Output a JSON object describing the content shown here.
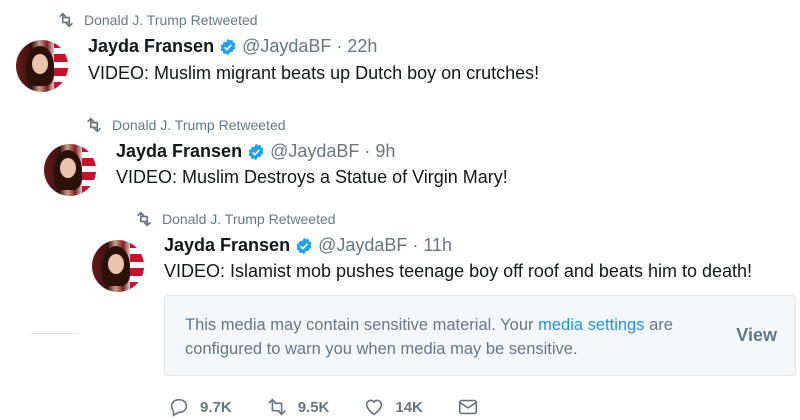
{
  "tweets": [
    {
      "retweet_label": "Donald J. Trump Retweeted",
      "name": "Jayda Fransen",
      "handle": "@JaydaBF",
      "dot": "·",
      "time": "22h",
      "text": "VIDEO: Muslim migrant beats up Dutch boy on crutches!"
    },
    {
      "retweet_label": "Donald J. Trump Retweeted",
      "name": "Jayda Fransen",
      "handle": "@JaydaBF",
      "dot": "·",
      "time": "9h",
      "text": "VIDEO: Muslim Destroys a Statue of Virgin Mary!"
    },
    {
      "retweet_label": "Donald J. Trump Retweeted",
      "name": "Jayda Fransen",
      "handle": "@JaydaBF",
      "dot": "·",
      "time": "11h",
      "text": "VIDEO: Islamist mob pushes teenage boy off roof and beats him to death!"
    }
  ],
  "sensitive_notice": {
    "text_before": "This media may contain sensitive material. Your ",
    "link": "media settings",
    "text_after": " are configured to warn you when media may be sensitive.",
    "view_label": "View"
  },
  "actions": {
    "reply_count": "9.7K",
    "retweet_count": "9.5K",
    "like_count": "14K"
  },
  "colors": {
    "secondary_text": "#657786",
    "link": "#1b95e0",
    "verified": "#1da1f2"
  },
  "icons": [
    "retweet-icon",
    "verified-badge-icon",
    "reply-icon",
    "like-icon",
    "message-icon"
  ]
}
